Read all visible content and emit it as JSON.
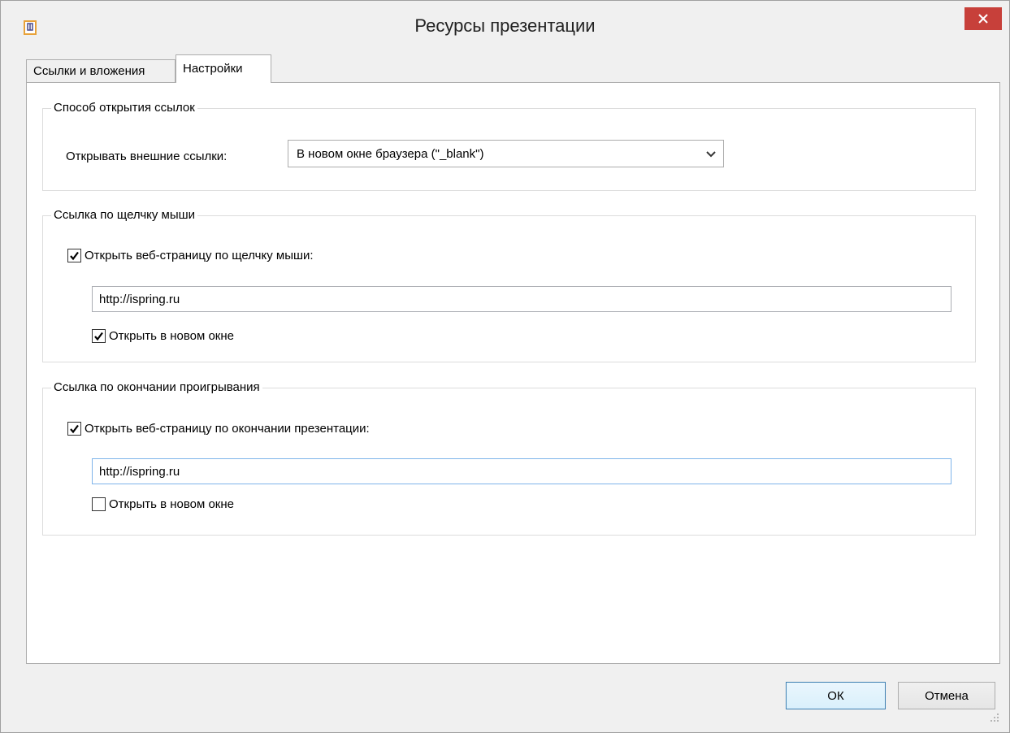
{
  "window": {
    "title": "Ресурсы презентации",
    "close_glyph": "✕"
  },
  "tabs": [
    {
      "label": "Ссылки и вложения",
      "selected": false
    },
    {
      "label": "Настройки",
      "selected": true
    }
  ],
  "groups": {
    "link_open": {
      "title": "Способ открытия ссылок",
      "field_label": "Открывать внешние ссылки:",
      "select_value": "В новом окне браузера (\"_blank\")"
    },
    "click_link": {
      "title": "Ссылка по щелчку мыши",
      "checkbox_label": "Открыть веб-страницу по щелчку мыши:",
      "checkbox_checked": true,
      "url_value": "http://ispring.ru",
      "new_window_label": "Открыть в новом окне",
      "new_window_checked": true
    },
    "end_link": {
      "title": "Ссылка по окончании проигрывания",
      "checkbox_label": "Открыть веб-страницу по окончании презентации:",
      "checkbox_checked": true,
      "url_value": "http://ispring.ru",
      "new_window_label": "Открыть в новом окне",
      "new_window_checked": false
    }
  },
  "buttons": {
    "ok": "ОК",
    "cancel": "Отмена"
  },
  "colors": {
    "close_button": "#c7403a",
    "focus_border": "#7eb4ea",
    "app_icon": "#e8a23a"
  }
}
